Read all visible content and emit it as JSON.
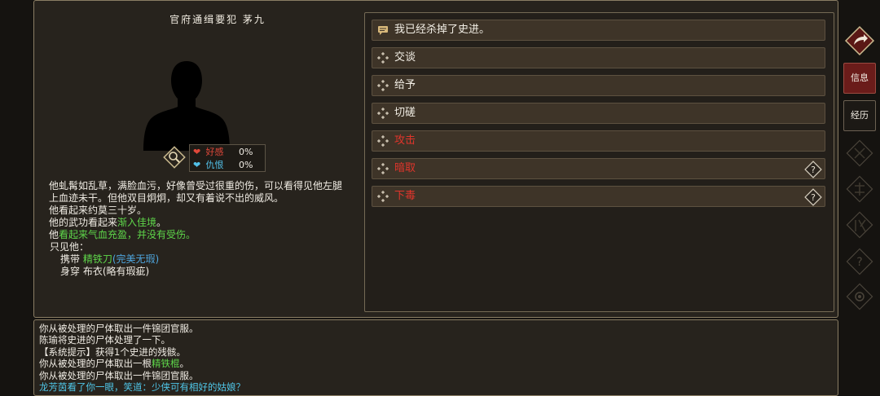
{
  "npc": {
    "title": "官府通缉要犯 茅九",
    "relations": {
      "favor_label": "好感",
      "favor_value": "0%",
      "hatred_label": "仇恨",
      "hatred_value": "0%"
    },
    "description": {
      "line1": "他虬髯如乱草，满脸血污，好像曾受过很重的伤，可以看得见他左腿上血迹未干。但他双目炯炯，却又有着说不出的威风。",
      "age": "他看起来约莫三十岁。",
      "martial_prefix": "他的武功看起来",
      "martial_level": "渐入佳境",
      "martial_suffix": "。",
      "health_prefix": "他",
      "health_status": "看起来气血充盈，并没有受伤。",
      "only_see": "只见他：",
      "carry_label": "携带",
      "carry_item": "精铁刀",
      "carry_quality": "(完美无瑕)",
      "wear_label": "身穿",
      "wear_item": "布衣",
      "wear_quality": "(略有瑕疵)"
    }
  },
  "actions": [
    {
      "label": "我已经杀掉了史进。",
      "icon": "dialog-icon",
      "color": "normal"
    },
    {
      "label": "交谈",
      "icon": "diamond-icon",
      "color": "normal"
    },
    {
      "label": "给予",
      "icon": "diamond-icon",
      "color": "normal"
    },
    {
      "label": "切磋",
      "icon": "diamond-icon",
      "color": "normal"
    },
    {
      "label": "攻击",
      "icon": "diamond-icon",
      "color": "red"
    },
    {
      "label": "暗取",
      "icon": "diamond-icon",
      "color": "red",
      "help": true
    },
    {
      "label": "下毒",
      "icon": "diamond-icon",
      "color": "red",
      "help": true
    }
  ],
  "log": {
    "l1": "你从被处理的尸体取出一件锦团官服。",
    "l2": "陈瑜将史进的尸体处理了一下。",
    "l3": "【系统提示】获得1个史进的残骸。",
    "l4_prefix": "你从被处理的尸体取出一根",
    "l4_item": "精铁棍",
    "l4_suffix": "。",
    "l5": "你从被处理的尸体取出一件锦团官服。",
    "l6": "龙芳茵看了你一眼，笑道：少侠可有相好的姑娘？"
  },
  "sidebar": {
    "info_label": "信息",
    "history_label": "经历"
  },
  "colors": {
    "panel_bg": "#27231d",
    "action_bg": "#3e3428",
    "green_text": "#5ed64a",
    "blue_text": "#4fa7e0",
    "red_text": "#e0352b",
    "cyan_text": "#4fc6e8",
    "active_tab": "#6a1c1a"
  }
}
